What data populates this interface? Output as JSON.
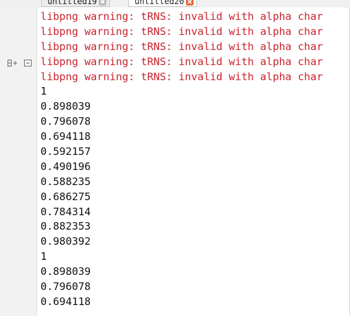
{
  "tabs": [
    {
      "label": "untitled19",
      "active": false
    },
    {
      "label": "untitled20",
      "active": true
    }
  ],
  "gutter_icons": [
    "expand-all-icon",
    "collapse-icon"
  ],
  "colors": {
    "warning_text": "#c8232c",
    "output_text": "#111111",
    "active_tab_close": "#e8653a",
    "inactive_tab_close": "#b9b9b9"
  },
  "console": {
    "warnings": [
      "libpng warning: tRNS: invalid with alpha char",
      "libpng warning: tRNS: invalid with alpha char",
      "libpng warning: tRNS: invalid with alpha char",
      "libpng warning: tRNS: invalid with alpha char",
      "libpng warning: tRNS: invalid with alpha char"
    ],
    "values": [
      "1",
      "0.898039",
      "0.796078",
      "0.694118",
      "0.592157",
      "0.490196",
      "0.588235",
      "0.686275",
      "0.784314",
      "0.882353",
      "0.980392",
      "1",
      "0.898039",
      "0.796078",
      "0.694118"
    ]
  }
}
